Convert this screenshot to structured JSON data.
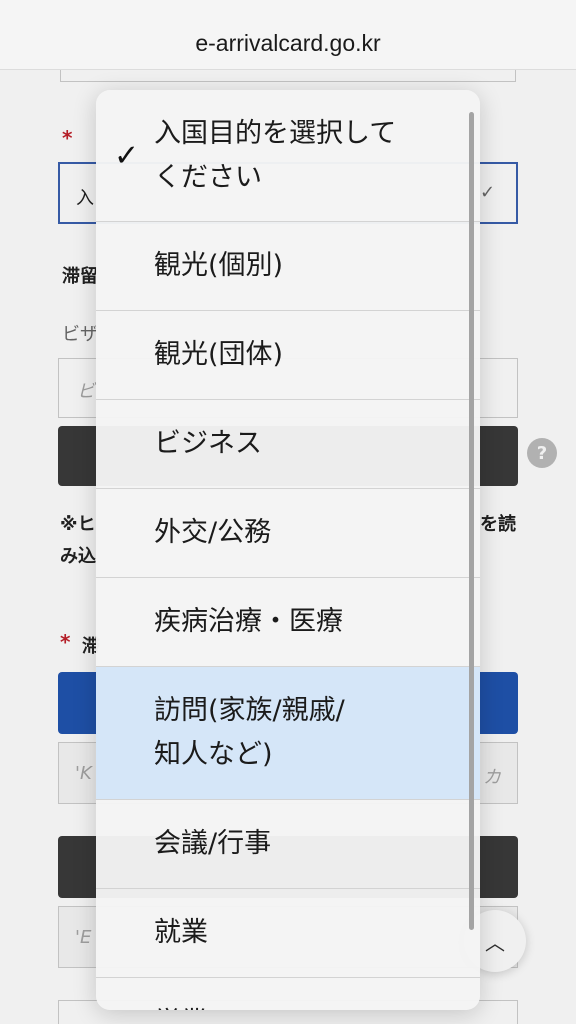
{
  "browser": {
    "url": "e-arrivalcard.go.kr"
  },
  "form": {
    "purpose_field_partial": "入",
    "stay_label_partial": "滞留",
    "visa_label_partial": "ビザ",
    "visa_input_partial": "ビ",
    "note_partial_left": "※ヒ",
    "note_partial_right": "を読",
    "note_partial_line2": "み込",
    "stay_addr_label_partial": "滞",
    "ko_input_partial": "'K",
    "ko_input_suffix": "カ",
    "en_input_partial": "'E",
    "help_symbol": "?",
    "dropdown_chevron": "✓",
    "scroll_top_symbol": "︿"
  },
  "picker": {
    "selected_check": "✓",
    "options": [
      {
        "label_line1": "入国目的を選択して",
        "label_line2": "ください"
      },
      {
        "label_line1": "観光(個別)"
      },
      {
        "label_line1": "観光(団体)"
      },
      {
        "label_line1": "ビジネス"
      },
      {
        "label_line1": "外交/公務"
      },
      {
        "label_line1": "疾病治療・医療"
      },
      {
        "label_line1": "訪問(家族/親戚/",
        "label_line2": "知人など)"
      },
      {
        "label_line1": "会議/行事"
      },
      {
        "label_line1": "就業"
      },
      {
        "label_line1": "学業"
      }
    ]
  }
}
